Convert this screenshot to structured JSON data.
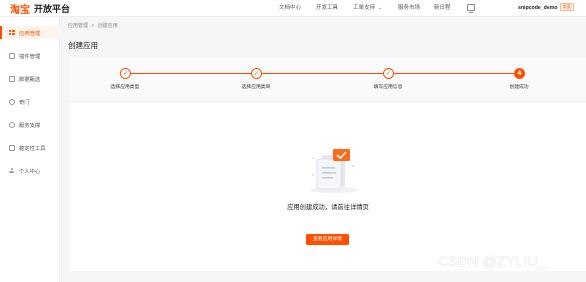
{
  "header": {
    "logo_mark": "淘宝",
    "logo_text": "开放平台",
    "nav": [
      "文档中心",
      "开发工具",
      "工单支持",
      "服务市场",
      "新日程"
    ],
    "user_name": "snipcode_demo",
    "user_badge": "卖家"
  },
  "sidebar": {
    "items": [
      {
        "label": "应用管理",
        "icon": "grid-icon",
        "active": true
      },
      {
        "label": "插件管理",
        "icon": "box-icon"
      },
      {
        "label": "数据甄选",
        "icon": "box-icon"
      },
      {
        "label": "奇门",
        "icon": "circle-icon"
      },
      {
        "label": "服务支撑",
        "icon": "circle-icon"
      },
      {
        "label": "稳定性工具",
        "icon": "box-icon"
      },
      {
        "label": "个人中心",
        "icon": "person-icon"
      }
    ]
  },
  "breadcrumb": {
    "root": "应用管理",
    "separator": ">",
    "current": "创建应用"
  },
  "page_title": "创建应用",
  "steps": [
    {
      "label": "选择应用类型",
      "status": "done",
      "mark": "✓"
    },
    {
      "label": "选择应用类目",
      "status": "done",
      "mark": "✓"
    },
    {
      "label": "填写应用信息",
      "status": "done",
      "mark": "✓"
    },
    {
      "label": "创建成功",
      "status": "current",
      "mark": "4"
    }
  ],
  "result": {
    "message": "应用创建成功，请前往详情页",
    "button_label": "查看应用详情"
  },
  "watermark": "CSDN @ZYLIU_",
  "colors": {
    "accent": "#ff5000",
    "background": "#f5f6f7"
  }
}
